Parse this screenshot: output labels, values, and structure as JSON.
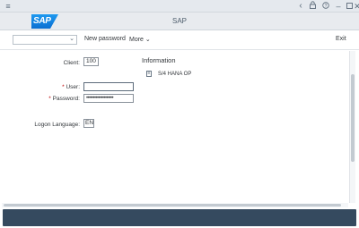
{
  "titlebar": {
    "icons": [
      "menu-icon",
      "back-icon",
      "lock-icon",
      "minimize-icon",
      "maximize-icon",
      "close-icon"
    ]
  },
  "shell": {
    "logo_text": "SAP",
    "title": "SAP"
  },
  "toolbar": {
    "dropdown_value": "",
    "new_password_label": "New password",
    "more_label": "More",
    "exit_label": "Exit"
  },
  "form": {
    "client_label": "Client:",
    "client_value": "100",
    "required_marker": "*",
    "user_label": "User:",
    "user_value": "",
    "password_label": "Password:",
    "password_value": "••••••••••••••••••••",
    "logon_language_label": "Logon Language:",
    "logon_language_value": "EN"
  },
  "information": {
    "title": "Information",
    "system_text": "S/4 HANA OP"
  },
  "colors": {
    "shell_background": "#e8ebef",
    "status_bar": "#354a5f",
    "brand_blue": "#0a6ed1",
    "required": "#bb0000"
  }
}
